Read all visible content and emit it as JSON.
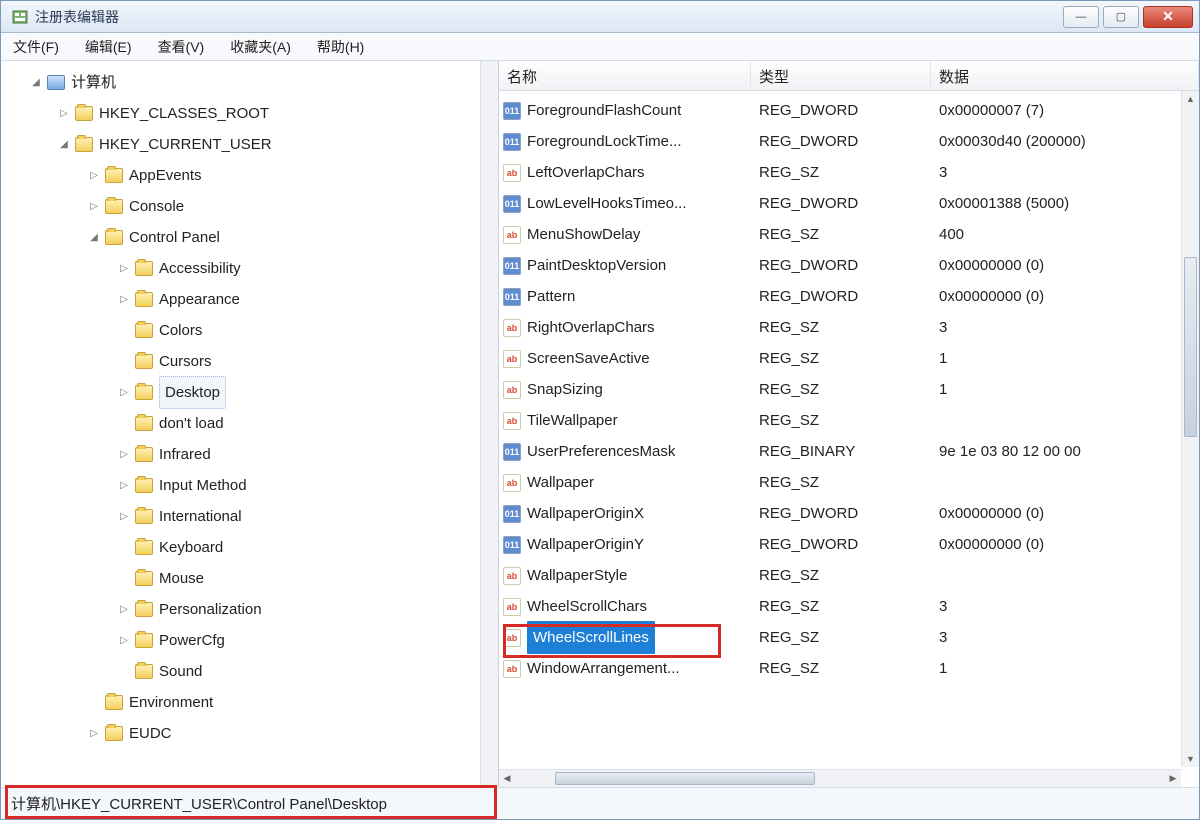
{
  "window": {
    "title": "注册表编辑器"
  },
  "menu": {
    "file": "文件(F)",
    "edit": "编辑(E)",
    "view": "查看(V)",
    "fav": "收藏夹(A)",
    "help": "帮助(H)"
  },
  "tree": {
    "root": "计算机",
    "items": [
      {
        "label": "HKEY_CLASSES_ROOT",
        "lvl": 2,
        "tw": "▷"
      },
      {
        "label": "HKEY_CURRENT_USER",
        "lvl": 2,
        "tw": "◢"
      },
      {
        "label": "AppEvents",
        "lvl": 3,
        "tw": "▷"
      },
      {
        "label": "Console",
        "lvl": 3,
        "tw": "▷"
      },
      {
        "label": "Control Panel",
        "lvl": 3,
        "tw": "◢"
      },
      {
        "label": "Accessibility",
        "lvl": 4,
        "tw": "▷"
      },
      {
        "label": "Appearance",
        "lvl": 4,
        "tw": "▷"
      },
      {
        "label": "Colors",
        "lvl": 4,
        "tw": ""
      },
      {
        "label": "Cursors",
        "lvl": 4,
        "tw": ""
      },
      {
        "label": "Desktop",
        "lvl": 4,
        "tw": "▷",
        "selected": true
      },
      {
        "label": "don't load",
        "lvl": 4,
        "tw": ""
      },
      {
        "label": "Infrared",
        "lvl": 4,
        "tw": "▷"
      },
      {
        "label": "Input Method",
        "lvl": 4,
        "tw": "▷"
      },
      {
        "label": "International",
        "lvl": 4,
        "tw": "▷"
      },
      {
        "label": "Keyboard",
        "lvl": 4,
        "tw": ""
      },
      {
        "label": "Mouse",
        "lvl": 4,
        "tw": ""
      },
      {
        "label": "Personalization",
        "lvl": 4,
        "tw": "▷"
      },
      {
        "label": "PowerCfg",
        "lvl": 4,
        "tw": "▷"
      },
      {
        "label": "Sound",
        "lvl": 4,
        "tw": ""
      },
      {
        "label": "Environment",
        "lvl": 3,
        "tw": ""
      },
      {
        "label": "EUDC",
        "lvl": 3,
        "tw": "▷"
      }
    ]
  },
  "list": {
    "cols": {
      "name": "名称",
      "type": "类型",
      "data": "数据"
    },
    "rows": [
      {
        "name": "ForegroundFlashCount",
        "type": "REG_DWORD",
        "data": "0x00000007 (7)",
        "icon": "bin"
      },
      {
        "name": "ForegroundLockTime...",
        "type": "REG_DWORD",
        "data": "0x00030d40 (200000)",
        "icon": "bin"
      },
      {
        "name": "LeftOverlapChars",
        "type": "REG_SZ",
        "data": "3",
        "icon": "sz"
      },
      {
        "name": "LowLevelHooksTimeo...",
        "type": "REG_DWORD",
        "data": "0x00001388 (5000)",
        "icon": "bin"
      },
      {
        "name": "MenuShowDelay",
        "type": "REG_SZ",
        "data": "400",
        "icon": "sz"
      },
      {
        "name": "PaintDesktopVersion",
        "type": "REG_DWORD",
        "data": "0x00000000 (0)",
        "icon": "bin"
      },
      {
        "name": "Pattern",
        "type": "REG_DWORD",
        "data": "0x00000000 (0)",
        "icon": "bin"
      },
      {
        "name": "RightOverlapChars",
        "type": "REG_SZ",
        "data": "3",
        "icon": "sz"
      },
      {
        "name": "ScreenSaveActive",
        "type": "REG_SZ",
        "data": "1",
        "icon": "sz"
      },
      {
        "name": "SnapSizing",
        "type": "REG_SZ",
        "data": "1",
        "icon": "sz"
      },
      {
        "name": "TileWallpaper",
        "type": "REG_SZ",
        "data": "",
        "icon": "sz"
      },
      {
        "name": "UserPreferencesMask",
        "type": "REG_BINARY",
        "data": "9e 1e 03 80 12 00 00",
        "icon": "bin"
      },
      {
        "name": "Wallpaper",
        "type": "REG_SZ",
        "data": "",
        "icon": "sz"
      },
      {
        "name": "WallpaperOriginX",
        "type": "REG_DWORD",
        "data": "0x00000000 (0)",
        "icon": "bin"
      },
      {
        "name": "WallpaperOriginY",
        "type": "REG_DWORD",
        "data": "0x00000000 (0)",
        "icon": "bin"
      },
      {
        "name": "WallpaperStyle",
        "type": "REG_SZ",
        "data": "",
        "icon": "sz"
      },
      {
        "name": "WheelScrollChars",
        "type": "REG_SZ",
        "data": "3",
        "icon": "sz"
      },
      {
        "name": "WheelScrollLines",
        "type": "REG_SZ",
        "data": "3",
        "icon": "sz",
        "selected": true
      },
      {
        "name": "WindowArrangement...",
        "type": "REG_SZ",
        "data": "1",
        "icon": "sz"
      }
    ]
  },
  "status": "计算机\\HKEY_CURRENT_USER\\Control Panel\\Desktop"
}
